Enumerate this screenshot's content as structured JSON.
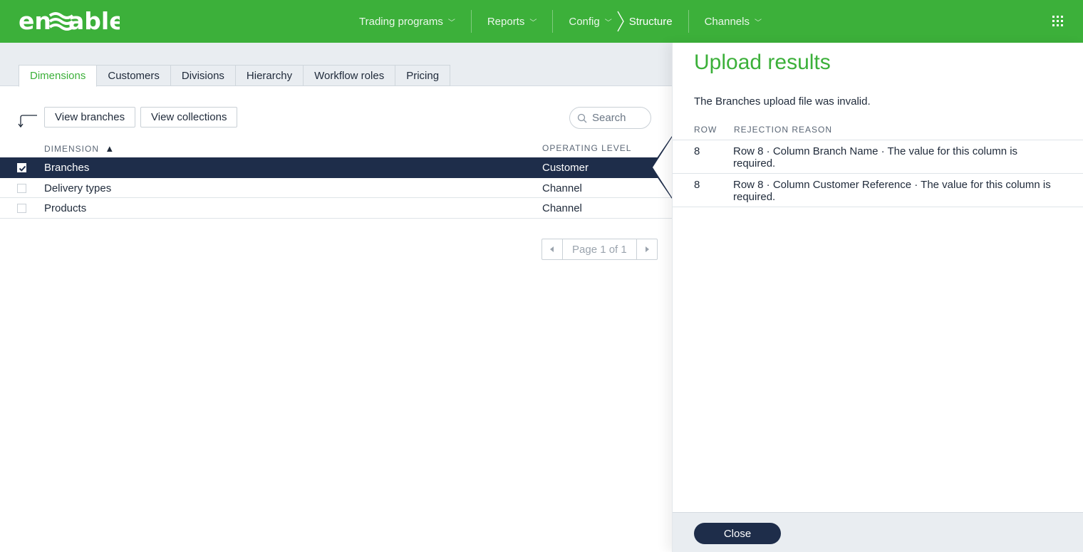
{
  "brand": {
    "logo_text": "en able",
    "accent": "#3cb03a",
    "navy": "#1e2d4a"
  },
  "nav": {
    "items": [
      {
        "label": "Trading programs"
      },
      {
        "label": "Reports"
      },
      {
        "label": "Config"
      },
      {
        "label": "Channels"
      }
    ],
    "breadcrumb_current": "Structure"
  },
  "tabs": [
    "Dimensions",
    "Customers",
    "Divisions",
    "Hierarchy",
    "Workflow roles",
    "Pricing"
  ],
  "toolbar": {
    "view_branches": "View branches",
    "view_collections": "View collections",
    "search_placeholder": "Search"
  },
  "table": {
    "columns": {
      "dimension": "DIMENSION",
      "operating_level": "OPERATING LEVEL"
    },
    "sort_indicator": "▲",
    "rows": [
      {
        "name": "Branches",
        "level": "Customer",
        "selected": true
      },
      {
        "name": "Delivery types",
        "level": "Channel",
        "selected": false
      },
      {
        "name": "Products",
        "level": "Channel",
        "selected": false
      }
    ]
  },
  "pager": {
    "text": "Page 1 of 1"
  },
  "panel": {
    "title": "Upload results",
    "message": "The Branches upload file was invalid.",
    "columns": {
      "row": "ROW",
      "reason": "REJECTION REASON"
    },
    "results": [
      {
        "row": "8",
        "reason": "Row 8 · Column Branch Name · The value for this column is required."
      },
      {
        "row": "8",
        "reason": "Row 8 · Column Customer Reference · The value for this column is required."
      }
    ],
    "close_label": "Close"
  }
}
